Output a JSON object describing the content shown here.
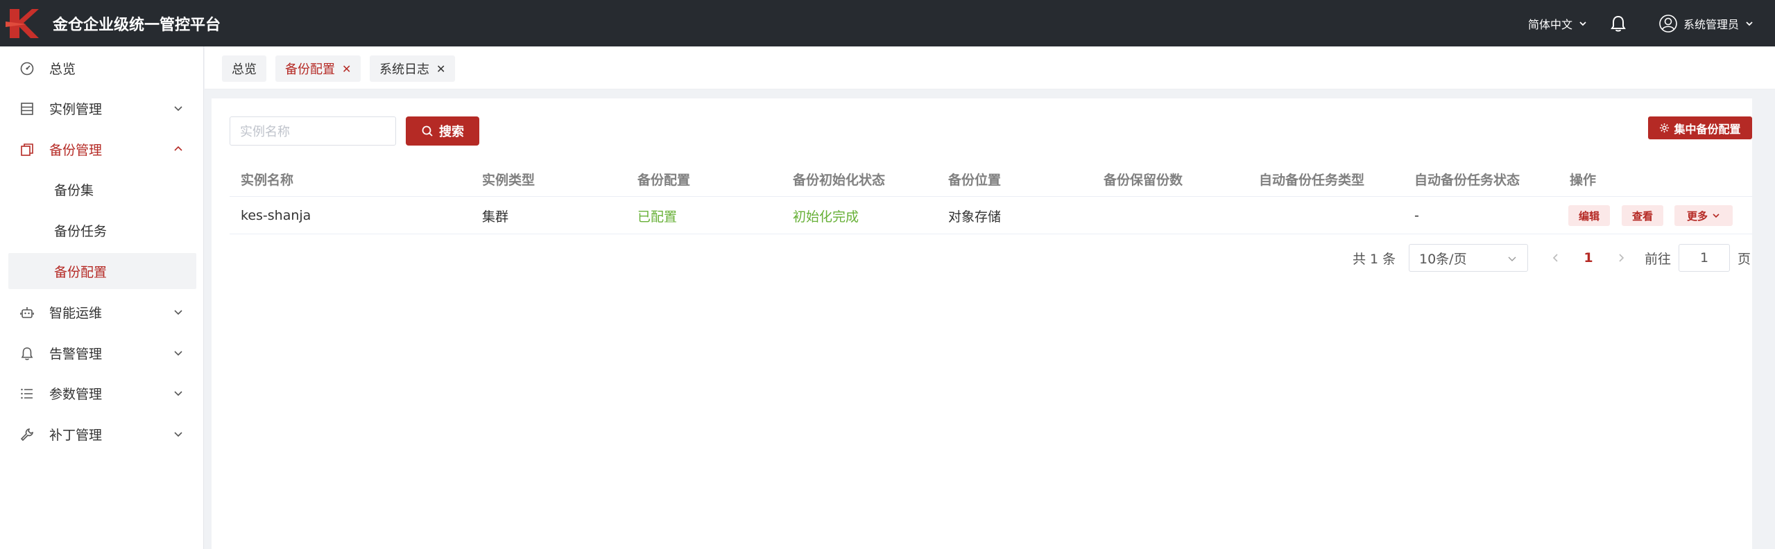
{
  "header": {
    "app_title": "金仓企业级统一管控平台",
    "language": "简体中文",
    "user": "系统管理员"
  },
  "sidebar": {
    "items": [
      {
        "label": "总览",
        "icon": "dashboard-icon"
      },
      {
        "label": "实例管理",
        "icon": "database-icon"
      },
      {
        "label": "备份管理",
        "icon": "copy-icon"
      },
      {
        "label": "智能运维",
        "icon": "robot-icon"
      },
      {
        "label": "告警管理",
        "icon": "bell-icon"
      },
      {
        "label": "参数管理",
        "icon": "list-icon"
      },
      {
        "label": "补丁管理",
        "icon": "wrench-icon"
      }
    ],
    "backup_sub": [
      {
        "label": "备份集"
      },
      {
        "label": "备份任务"
      },
      {
        "label": "备份配置"
      }
    ]
  },
  "tabs": [
    {
      "label": "总览"
    },
    {
      "label": "备份配置"
    },
    {
      "label": "系统日志"
    }
  ],
  "search": {
    "placeholder": "实例名称",
    "button": "搜索"
  },
  "central_button": "集中备份配置",
  "table": {
    "columns": [
      "实例名称",
      "实例类型",
      "备份配置",
      "备份初始化状态",
      "备份位置",
      "备份保留份数",
      "自动备份任务类型",
      "自动备份任务状态",
      "操作"
    ],
    "rows": [
      {
        "name": "kes-shanja",
        "type": "集群",
        "config": "已配置",
        "init_status": "初始化完成",
        "location": "对象存储",
        "retention": "",
        "auto_type": "",
        "auto_status": "-",
        "actions": {
          "edit": "编辑",
          "view": "查看",
          "more": "更多"
        }
      }
    ]
  },
  "pagination": {
    "total": "共 1 条",
    "page_size": "10条/页",
    "current": "1",
    "goto_label": "前往",
    "goto_value": "1",
    "page_label": "页"
  },
  "colors": {
    "accent": "#b52a25",
    "topbar": "#272b30",
    "success": "#67b037"
  }
}
